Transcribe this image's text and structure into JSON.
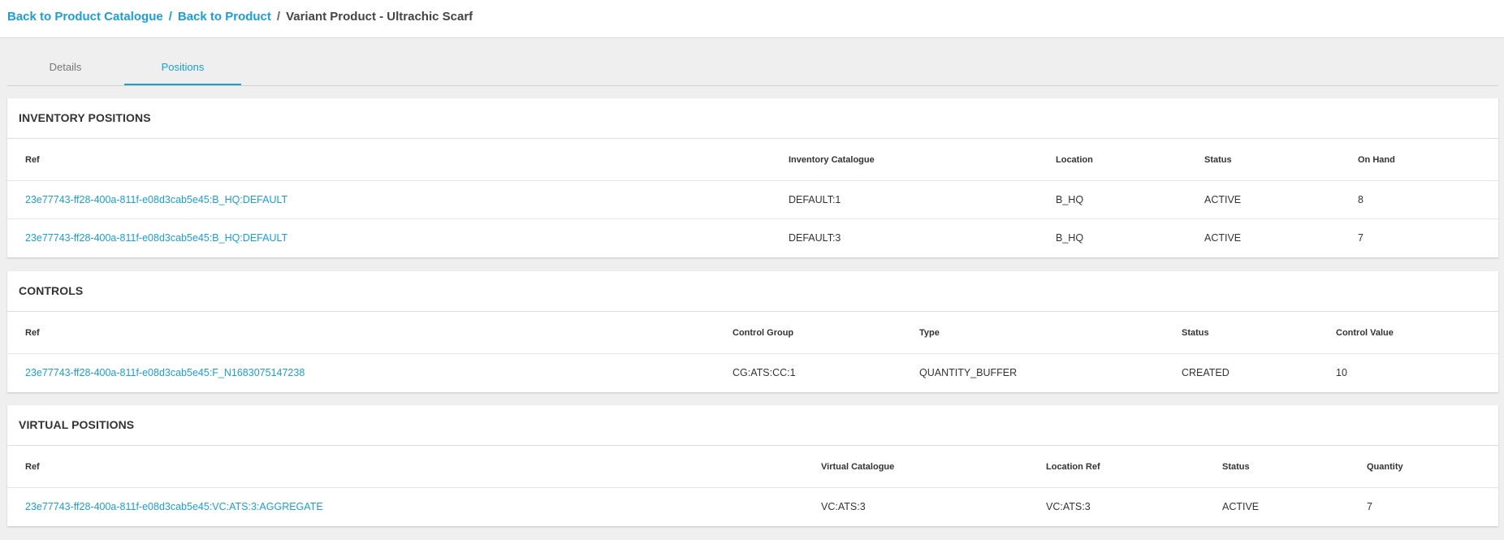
{
  "breadcrumb": {
    "back_catalogue": "Back to Product Catalogue",
    "sep1": "/",
    "back_product": "Back to Product",
    "sep2": "/",
    "current": "Variant Product - Ultrachic Scarf"
  },
  "tabs": {
    "details": "Details",
    "positions": "Positions",
    "active": "Positions"
  },
  "inventory": {
    "title": "INVENTORY POSITIONS",
    "columns": [
      "Ref",
      "Inventory Catalogue",
      "Location",
      "Status",
      "On Hand"
    ],
    "rows": [
      [
        "23e77743-ff28-400a-811f-e08d3cab5e45:B_HQ:DEFAULT",
        "DEFAULT:1",
        "B_HQ",
        "ACTIVE",
        "8"
      ],
      [
        "23e77743-ff28-400a-811f-e08d3cab5e45:B_HQ:DEFAULT",
        "DEFAULT:3",
        "B_HQ",
        "ACTIVE",
        "7"
      ]
    ]
  },
  "controls": {
    "title": "CONTROLS",
    "columns": [
      "Ref",
      "Control Group",
      "Type",
      "Status",
      "Control Value"
    ],
    "rows": [
      [
        "23e77743-ff28-400a-811f-e08d3cab5e45:F_N1683075147238",
        "CG:ATS:CC:1",
        "QUANTITY_BUFFER",
        "CREATED",
        "10"
      ]
    ]
  },
  "virtual": {
    "title": "VIRTUAL POSITIONS",
    "columns": [
      "Ref",
      "Virtual Catalogue",
      "Location Ref",
      "Status",
      "Quantity"
    ],
    "rows": [
      [
        "23e77743-ff28-400a-811f-e08d3cab5e45:VC:ATS:3:AGGREGATE",
        "VC:ATS:3",
        "VC:ATS:3",
        "ACTIVE",
        "7"
      ]
    ]
  },
  "colors": {
    "accent": "#1a9fd6",
    "background": "#efefef",
    "card": "#ffffff"
  }
}
